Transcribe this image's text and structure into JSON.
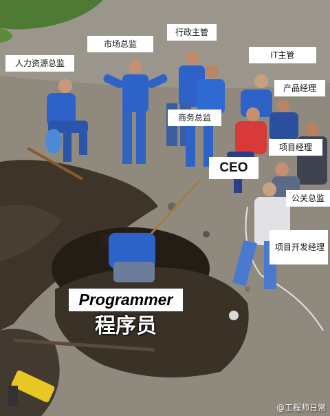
{
  "labels": {
    "hr_director": "人力资源总监",
    "marketing_director": "市场总监",
    "admin_manager": "行政主管",
    "it_manager": "IT主管",
    "product_manager": "产品经理",
    "business_director": "商务总监",
    "ceo": "CEO",
    "project_manager": "项目经理",
    "pr_director": "公关总监",
    "project_dev_manager": "项目开发经理",
    "programmer_en": "Programmer",
    "programmer_cn": "程序员"
  },
  "watermark": "@工程师日常",
  "colors": {
    "ground": "#8a8478",
    "dirt": "#3e3429",
    "uniform_blue": "#2d62c8",
    "grass": "#4f7a33"
  }
}
